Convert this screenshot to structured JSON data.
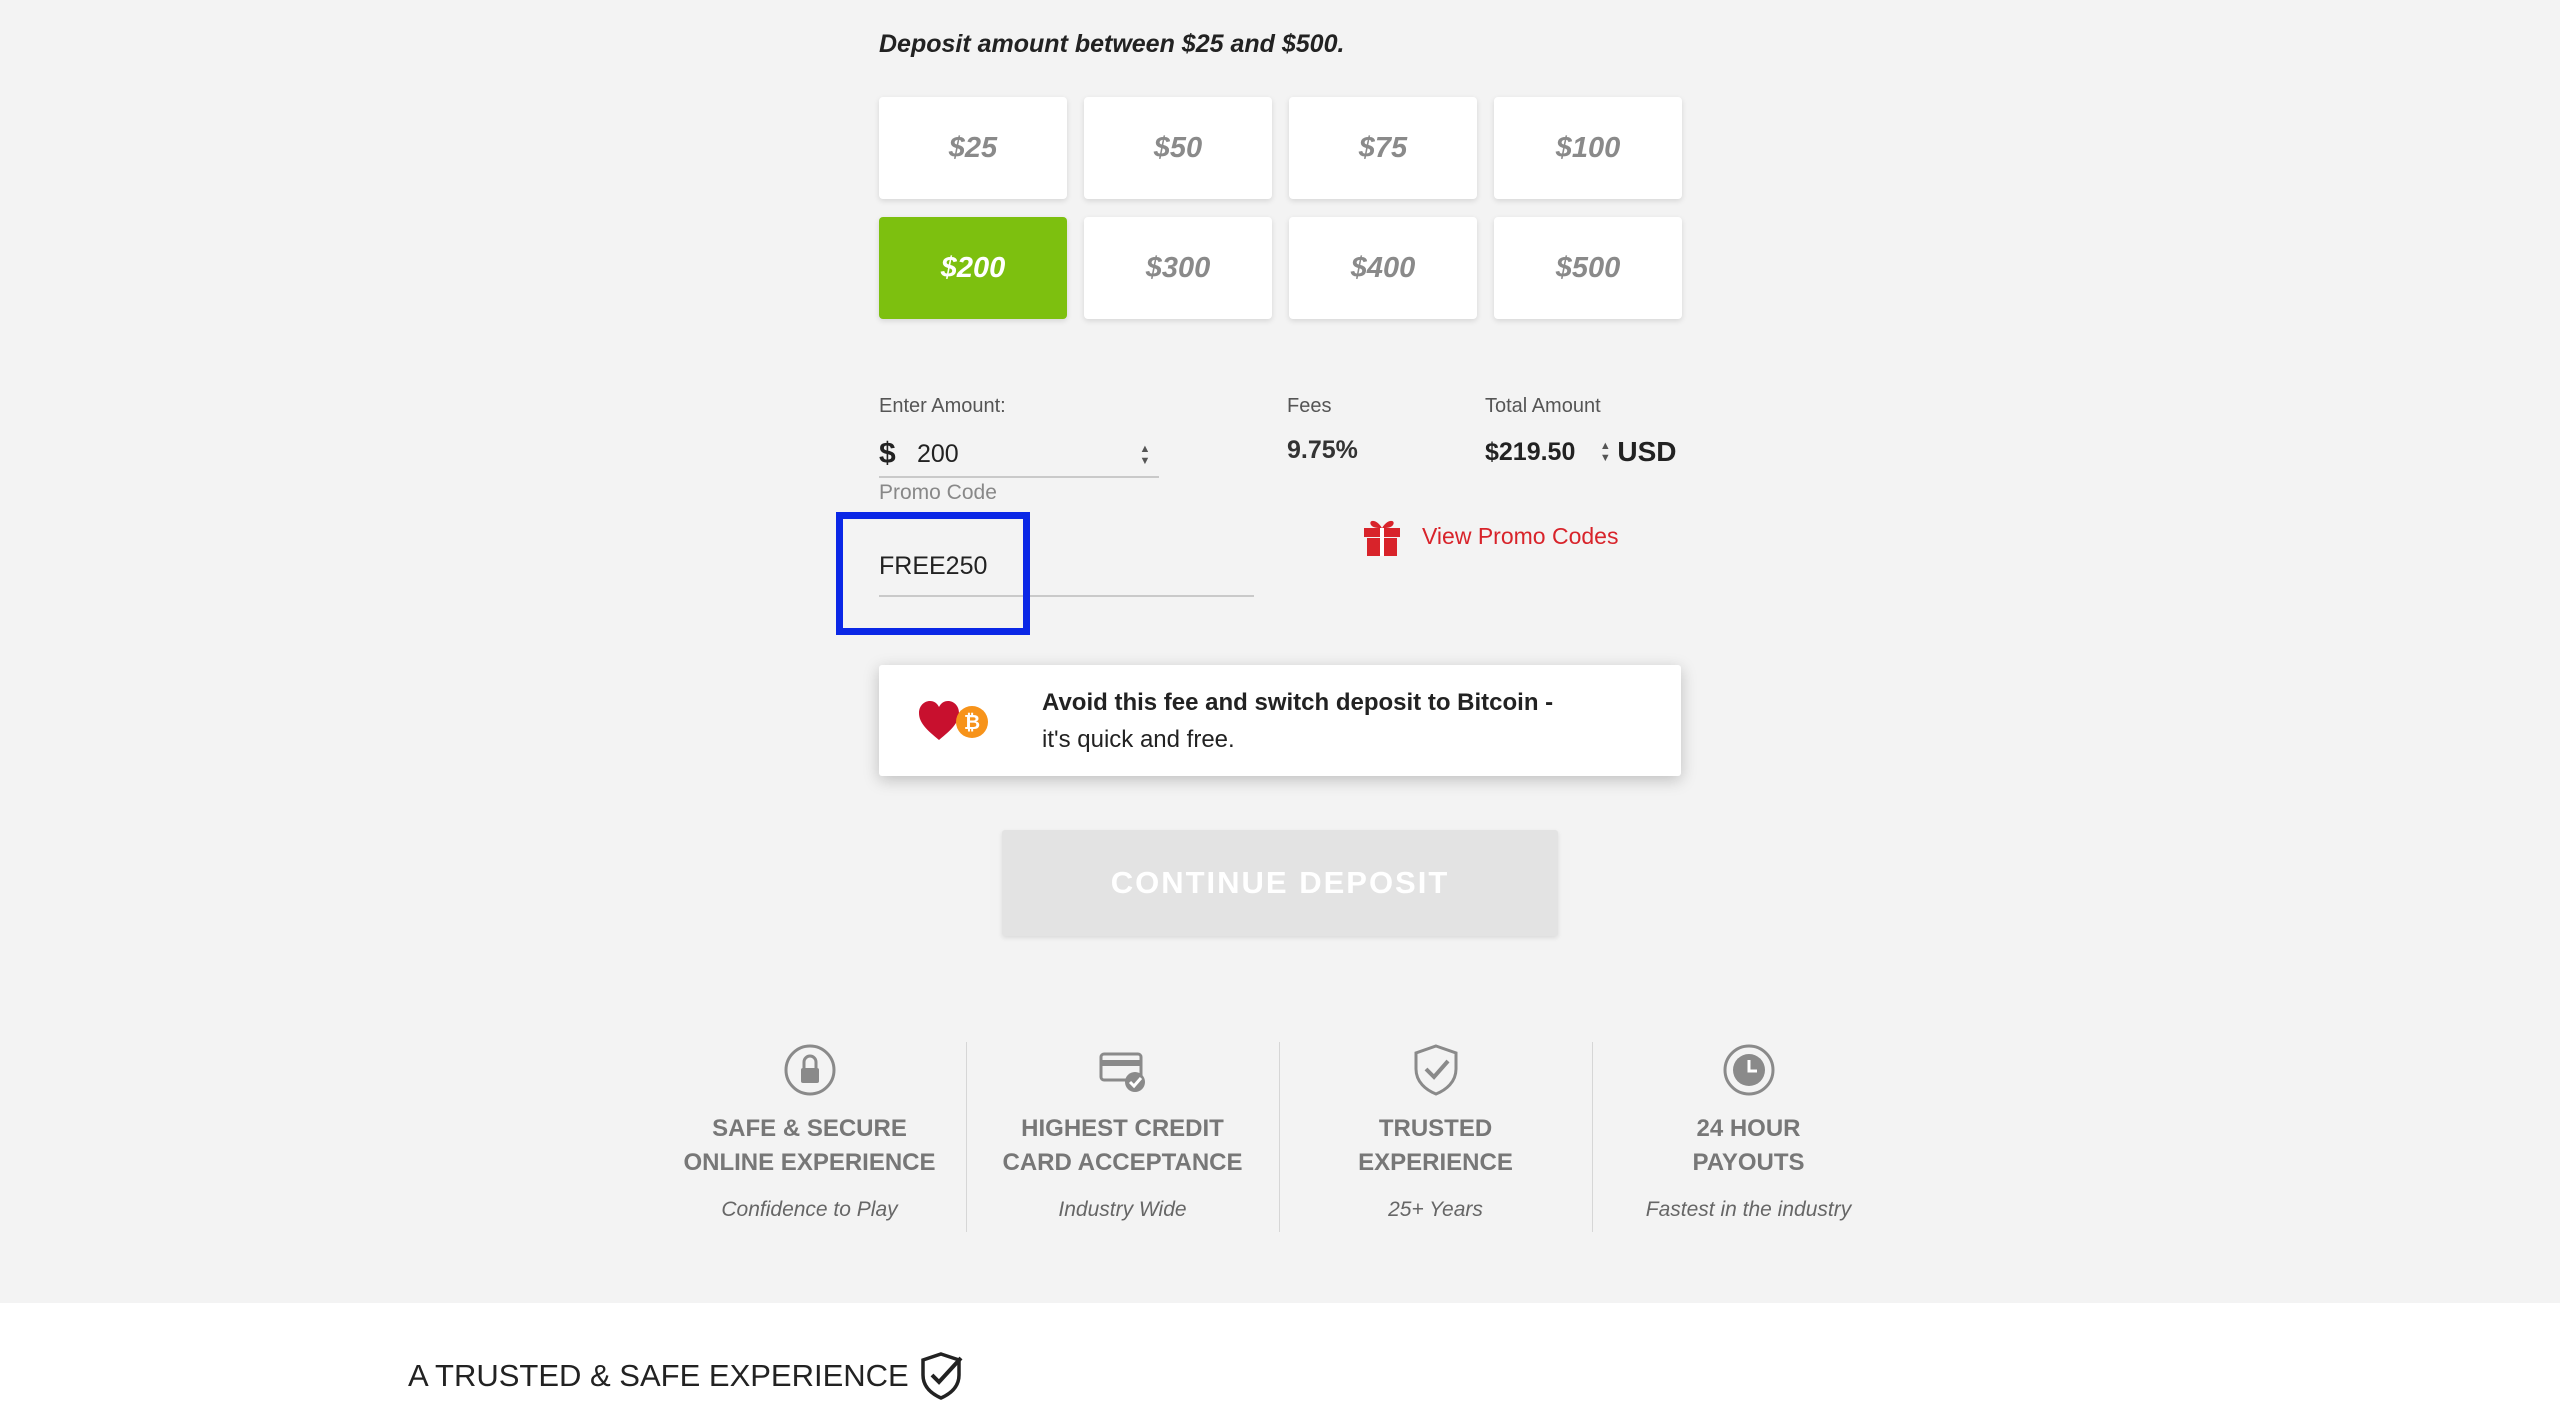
{
  "deposit_hint": "Deposit amount between $25 and $500.",
  "amount_options": [
    {
      "label": "$25",
      "selected": false
    },
    {
      "label": "$50",
      "selected": false
    },
    {
      "label": "$75",
      "selected": false
    },
    {
      "label": "$100",
      "selected": false
    },
    {
      "label": "$200",
      "selected": true
    },
    {
      "label": "$300",
      "selected": false
    },
    {
      "label": "$400",
      "selected": false
    },
    {
      "label": "$500",
      "selected": false
    }
  ],
  "enter_amount": {
    "label": "Enter Amount:",
    "currency_symbol": "$",
    "value": "200"
  },
  "fees": {
    "label": "Fees",
    "value": "9.75%"
  },
  "total": {
    "label": "Total Amount",
    "value": "$219.50",
    "currency": "USD"
  },
  "promo": {
    "label": "Promo Code",
    "value": "FREE250",
    "view_link": "View Promo Codes"
  },
  "bitcoin_banner": {
    "bold_text": "Avoid this fee and switch deposit to Bitcoin -",
    "text": "it's quick and free."
  },
  "continue_button": "CONTINUE DEPOSIT",
  "features": [
    {
      "icon": "lock-icon",
      "title": "SAFE & SECURE\nONLINE EXPERIENCE",
      "subtitle": "Confidence to Play"
    },
    {
      "icon": "credit-card-icon",
      "title": "HIGHEST CREDIT\nCARD ACCEPTANCE",
      "subtitle": "Industry Wide"
    },
    {
      "icon": "shield-check-icon",
      "title": "TRUSTED\nEXPERIENCE",
      "subtitle": "25+ Years"
    },
    {
      "icon": "clock-icon",
      "title": "24 HOUR\nPAYOUTS",
      "subtitle": "Fastest in the industry"
    }
  ],
  "footer_title": "A TRUSTED & SAFE EXPERIENCE",
  "colors": {
    "selected_green": "#7dc00f",
    "highlight_blue": "#0a27e6",
    "promo_red": "#d8232a"
  }
}
